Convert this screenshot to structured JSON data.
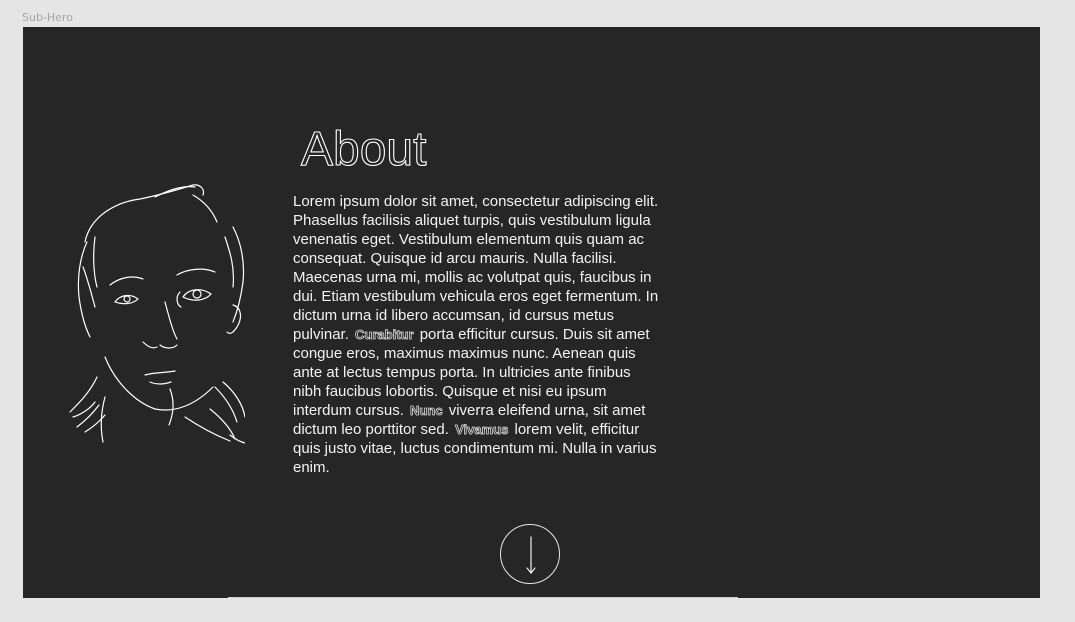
{
  "frame": {
    "label": "Sub-Hero"
  },
  "about": {
    "title": "About",
    "paragraph_part1": "Lorem ipsum dolor sit amet, consectetur adipiscing elit. Phasellus facilisis aliquet turpis, quis vestibulum ligula venenatis eget. Vestibulum elementum quis quam ac consequat. Quisque id arcu mauris. Nulla facilisi. Maecenas urna mi, mollis ac volutpat quis, faucibus in dui. Etiam vestibulum vehicula eros eget fermentum. In dictum urna id libero accumsan, id cursus metus pulvinar.",
    "outlined_word1": "Curabitur",
    "paragraph_part2": "porta efficitur cursus. Duis sit amet congue eros, maximus maximus nunc. Aenean quis ante at lectus tempus porta. In ultricies ante finibus nibh faucibus lobortis. Quisque et nisi eu ipsum interdum cursus.",
    "outlined_word2": "Nunc",
    "paragraph_part3": "viverra eleifend urna, sit amet dictum leo porttitor sed.",
    "outlined_word3": "Vivamus",
    "paragraph_part4": "lorem velit, efficitur quis justo vitae, luctus condimentum mi. Nulla in varius enim."
  },
  "icons": {
    "portrait": "line-art-face-portrait",
    "scroll": "arrow-down-icon"
  },
  "colors": {
    "page_background": "#e5e5e5",
    "frame_background": "#262626",
    "text": "#f2f2f2",
    "outline": "#d8d8d8"
  }
}
